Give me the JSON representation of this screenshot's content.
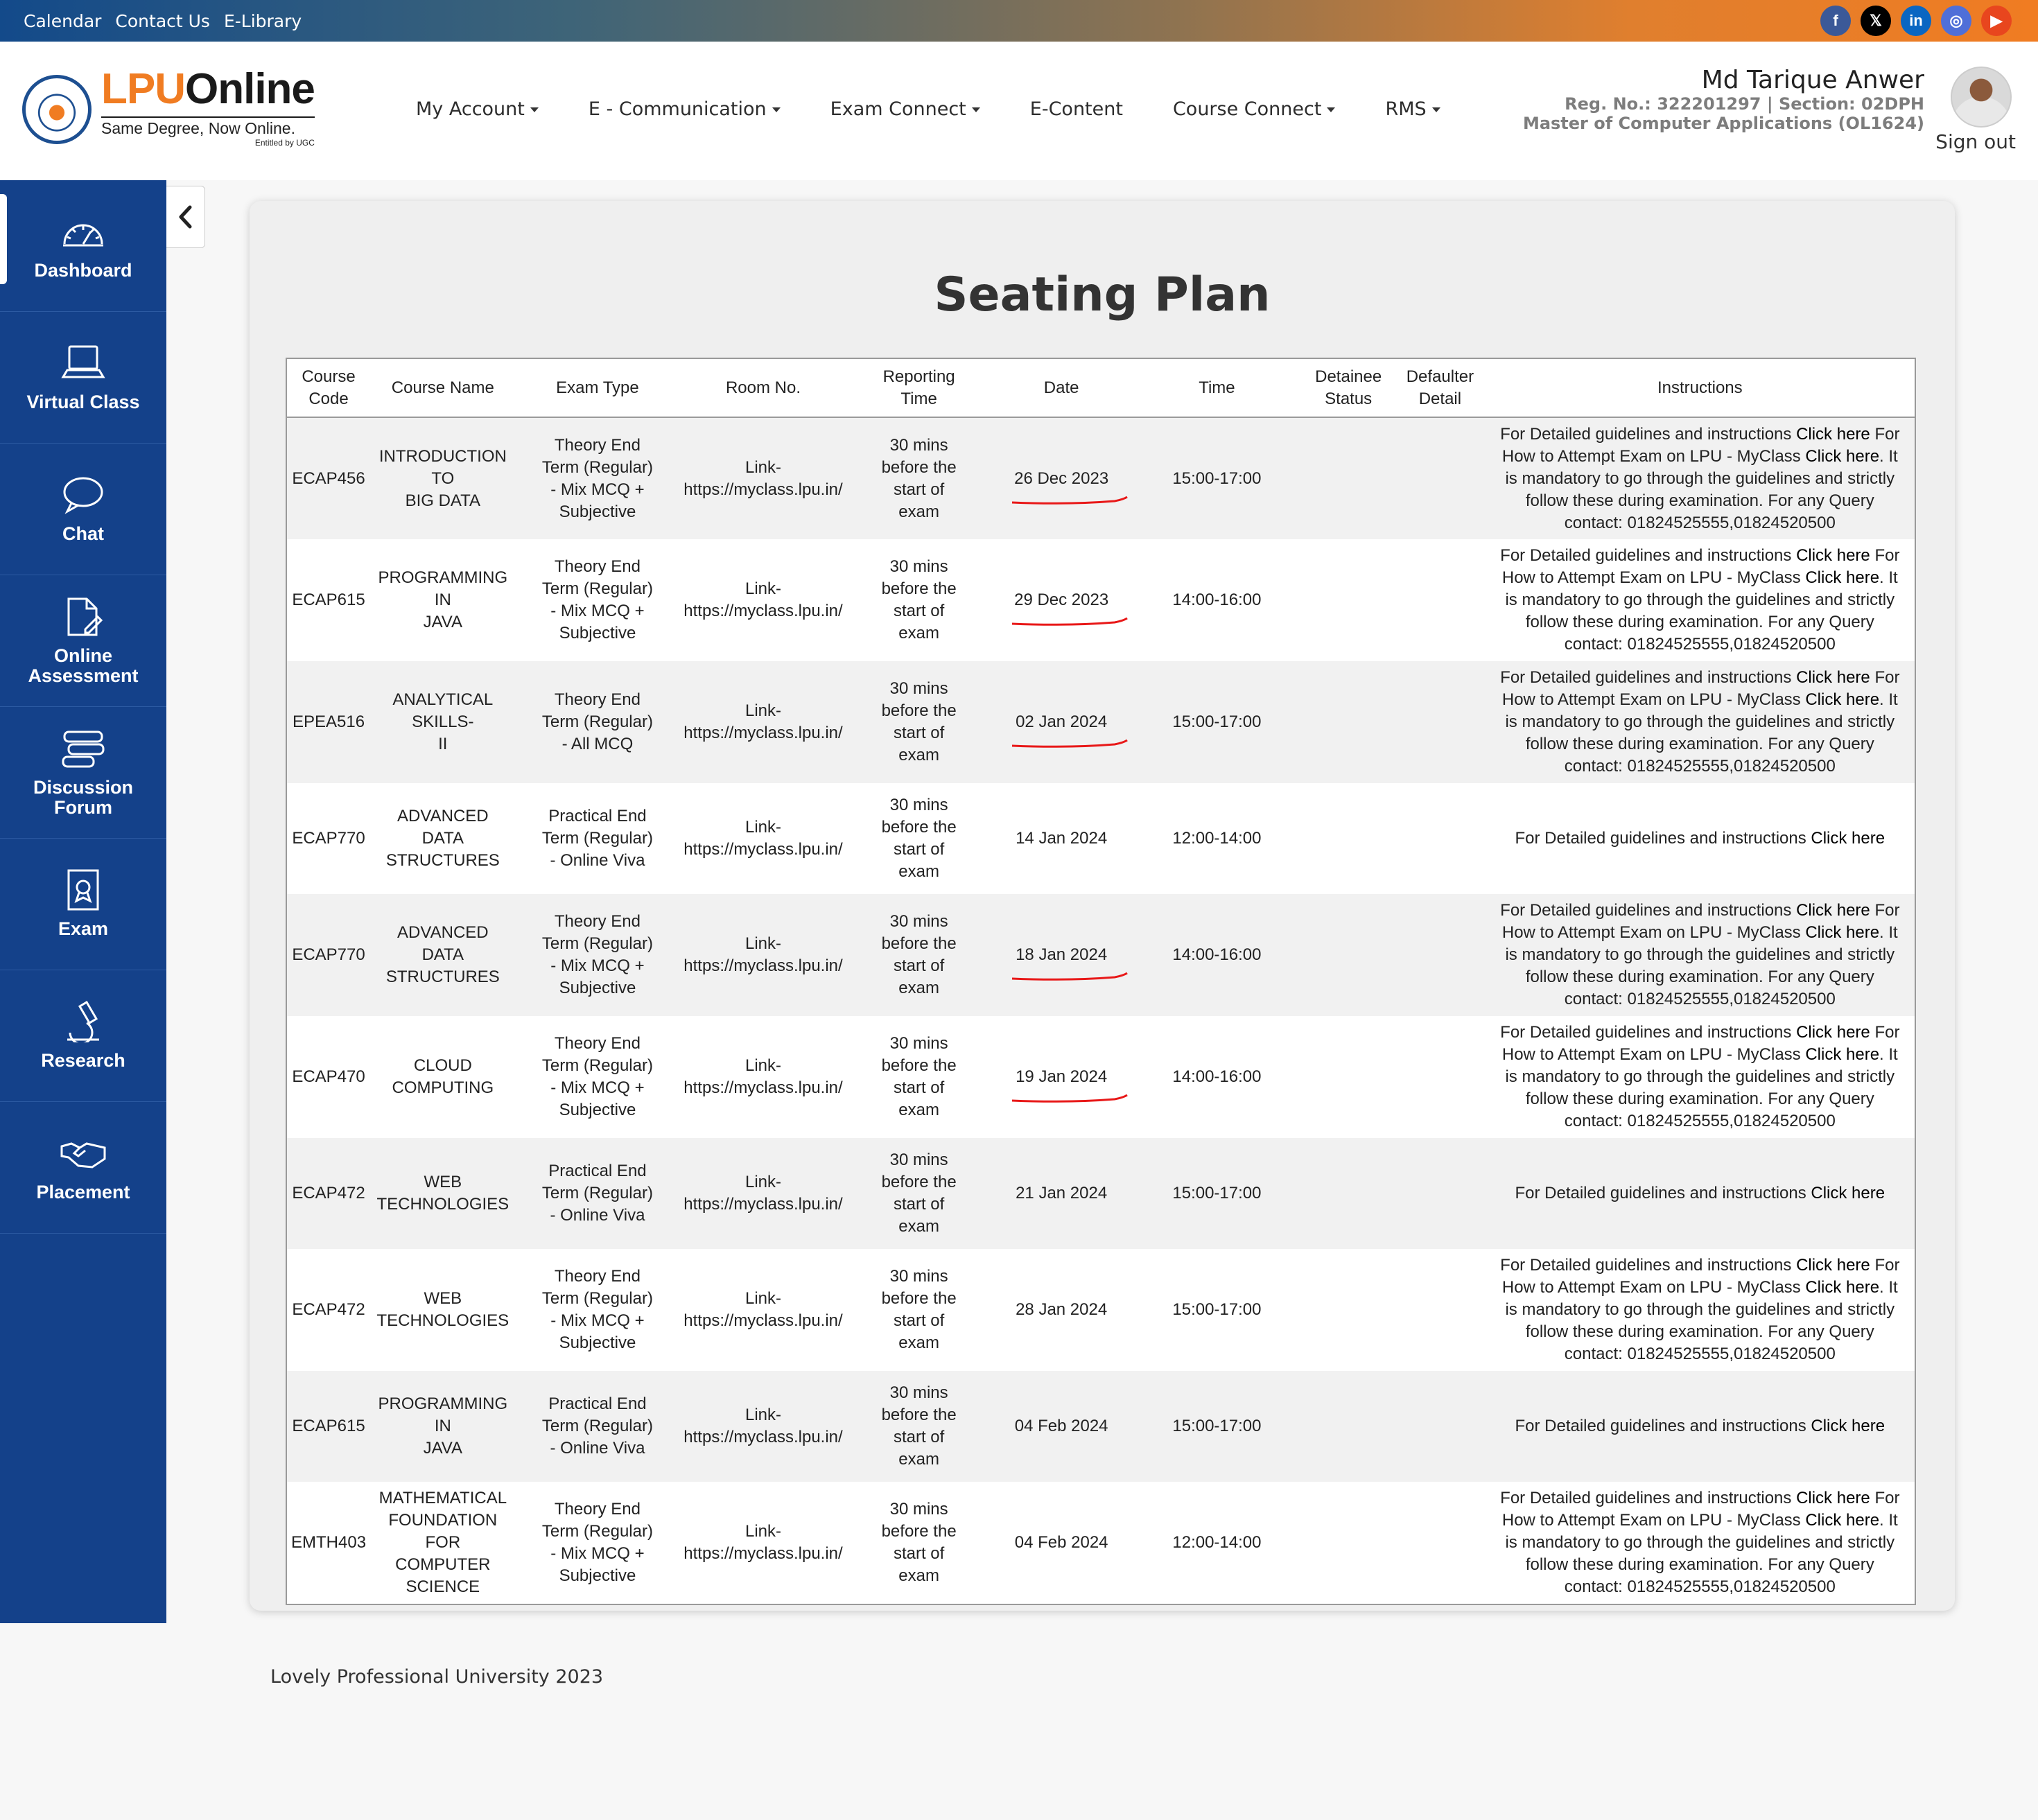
{
  "topbar": {
    "links": [
      "Calendar",
      "Contact Us",
      "E-Library"
    ],
    "socials": [
      {
        "icon": "facebook-icon",
        "glyph": "f",
        "color": "#3b5998"
      },
      {
        "icon": "x-twitter-icon",
        "glyph": "𝕏",
        "color": "#000000"
      },
      {
        "icon": "linkedin-icon",
        "glyph": "in",
        "color": "#0a66c2"
      },
      {
        "icon": "instagram-icon",
        "glyph": "◎",
        "color": "#4f6fd8"
      },
      {
        "icon": "youtube-icon",
        "glyph": "▶",
        "color": "#e8461e"
      }
    ]
  },
  "logo": {
    "main_1": "LPU",
    "main_2": "Online",
    "tagline": "Same Degree, Now Online.",
    "sub": "Entitled by UGC"
  },
  "nav": [
    {
      "label": "My Account",
      "dropdown": true
    },
    {
      "label": "E - Communication",
      "dropdown": true
    },
    {
      "label": "Exam Connect",
      "dropdown": true
    },
    {
      "label": "E-Content",
      "dropdown": false
    },
    {
      "label": "Course Connect",
      "dropdown": true
    },
    {
      "label": "RMS",
      "dropdown": true
    }
  ],
  "user": {
    "name": "Md Tarique Anwer",
    "reg": "Reg. No.: 322201297 | Section: 02DPH",
    "program": "Master of Computer Applications (OL1624)",
    "signout": "Sign out"
  },
  "sidebar": [
    {
      "label": "Dashboard",
      "icon": "dashboard-gauge-icon",
      "active": true
    },
    {
      "label": "Virtual Class",
      "icon": "laptop-icon",
      "active": false
    },
    {
      "label": "Chat",
      "icon": "chat-bubble-icon",
      "active": false
    },
    {
      "label": "Online\nAssessment",
      "icon": "document-edit-icon",
      "active": false
    },
    {
      "label": "Discussion\nForum",
      "icon": "discussion-icon",
      "active": false
    },
    {
      "label": "Exam",
      "icon": "exam-certificate-icon",
      "active": false
    },
    {
      "label": "Research",
      "icon": "microscope-icon",
      "active": false
    },
    {
      "label": "Placement",
      "icon": "handshake-icon",
      "active": false
    }
  ],
  "page": {
    "title": "Seating Plan"
  },
  "table": {
    "headers": [
      "Course\nCode",
      "Course Name",
      "Exam Type",
      "Room No.",
      "Reporting\nTime",
      "Date",
      "Time",
      "Detainee\nStatus",
      "Defaulter\nDetail",
      "Instructions"
    ],
    "rows": [
      {
        "code": "ECAP456",
        "name": "INTRODUCTION TO\nBIG DATA",
        "type": "Theory End\nTerm (Regular)\n- Mix MCQ +\nSubjective",
        "room": "Link-\nhttps://myclass.lpu.in/",
        "reporting": "30 mins\nbefore the\nstart of\nexam",
        "date": "26 Dec 2023",
        "time": "15:00-17:00",
        "detainee": "",
        "defaulter": "",
        "instructions": "full",
        "underlined": true
      },
      {
        "code": "ECAP615",
        "name": "PROGRAMMING IN\nJAVA",
        "type": "Theory End\nTerm (Regular)\n- Mix MCQ +\nSubjective",
        "room": "Link-\nhttps://myclass.lpu.in/",
        "reporting": "30 mins\nbefore the\nstart of\nexam",
        "date": "29 Dec 2023",
        "time": "14:00-16:00",
        "detainee": "",
        "defaulter": "",
        "instructions": "full",
        "underlined": true
      },
      {
        "code": "EPEA516",
        "name": "ANALYTICAL SKILLS-\nII",
        "type": "Theory End\nTerm (Regular)\n- All MCQ",
        "room": "Link-\nhttps://myclass.lpu.in/",
        "reporting": "30 mins\nbefore the\nstart of\nexam",
        "date": "02 Jan 2024",
        "time": "15:00-17:00",
        "detainee": "",
        "defaulter": "",
        "instructions": "full",
        "underlined": true
      },
      {
        "code": "ECAP770",
        "name": "ADVANCED DATA\nSTRUCTURES",
        "type": "Practical End\nTerm (Regular)\n- Online Viva",
        "room": "Link-\nhttps://myclass.lpu.in/",
        "reporting": "30 mins\nbefore the\nstart of\nexam",
        "date": "14 Jan 2024",
        "time": "12:00-14:00",
        "detainee": "",
        "defaulter": "",
        "instructions": "short",
        "underlined": false
      },
      {
        "code": "ECAP770",
        "name": "ADVANCED DATA\nSTRUCTURES",
        "type": "Theory End\nTerm (Regular)\n- Mix MCQ +\nSubjective",
        "room": "Link-\nhttps://myclass.lpu.in/",
        "reporting": "30 mins\nbefore the\nstart of\nexam",
        "date": "18 Jan 2024",
        "time": "14:00-16:00",
        "detainee": "",
        "defaulter": "",
        "instructions": "full",
        "underlined": true
      },
      {
        "code": "ECAP470",
        "name": "CLOUD COMPUTING",
        "type": "Theory End\nTerm (Regular)\n- Mix MCQ +\nSubjective",
        "room": "Link-\nhttps://myclass.lpu.in/",
        "reporting": "30 mins\nbefore the\nstart of\nexam",
        "date": "19 Jan 2024",
        "time": "14:00-16:00",
        "detainee": "",
        "defaulter": "",
        "instructions": "full",
        "underlined": true
      },
      {
        "code": "ECAP472",
        "name": "WEB TECHNOLOGIES",
        "type": "Practical End\nTerm (Regular)\n- Online Viva",
        "room": "Link-\nhttps://myclass.lpu.in/",
        "reporting": "30 mins\nbefore the\nstart of\nexam",
        "date": "21 Jan 2024",
        "time": "15:00-17:00",
        "detainee": "",
        "defaulter": "",
        "instructions": "short",
        "underlined": false
      },
      {
        "code": "ECAP472",
        "name": "WEB TECHNOLOGIES",
        "type": "Theory End\nTerm (Regular)\n- Mix MCQ +\nSubjective",
        "room": "Link-\nhttps://myclass.lpu.in/",
        "reporting": "30 mins\nbefore the\nstart of\nexam",
        "date": "28 Jan 2024",
        "time": "15:00-17:00",
        "detainee": "",
        "defaulter": "",
        "instructions": "full",
        "underlined": false
      },
      {
        "code": "ECAP615",
        "name": "PROGRAMMING IN\nJAVA",
        "type": "Practical End\nTerm (Regular)\n- Online Viva",
        "room": "Link-\nhttps://myclass.lpu.in/",
        "reporting": "30 mins\nbefore the\nstart of\nexam",
        "date": "04 Feb 2024",
        "time": "15:00-17:00",
        "detainee": "",
        "defaulter": "",
        "instructions": "short",
        "underlined": false
      },
      {
        "code": "EMTH403",
        "name": "MATHEMATICAL\nFOUNDATION FOR\nCOMPUTER SCIENCE",
        "type": "Theory End\nTerm (Regular)\n- Mix MCQ +\nSubjective",
        "room": "Link-\nhttps://myclass.lpu.in/",
        "reporting": "30 mins\nbefore the\nstart of\nexam",
        "date": "04 Feb 2024",
        "time": "12:00-14:00",
        "detainee": "",
        "defaulter": "",
        "instructions": "full",
        "underlined": false
      }
    ],
    "instructions": {
      "guidelines_text": "For Detailed guidelines and instructions ",
      "guidelines_link": "Click here",
      "attempt_text": "For How to Attempt Exam on LPU - MyClass ",
      "attempt_link": "Click here",
      "mandatory_text": ". It is mandatory to go through the guidelines and strictly follow these during examination. For any Query contact: 01824525555,01824520500"
    },
    "annotation_color": "#e81818"
  },
  "footer": "Lovely Professional University 2023"
}
